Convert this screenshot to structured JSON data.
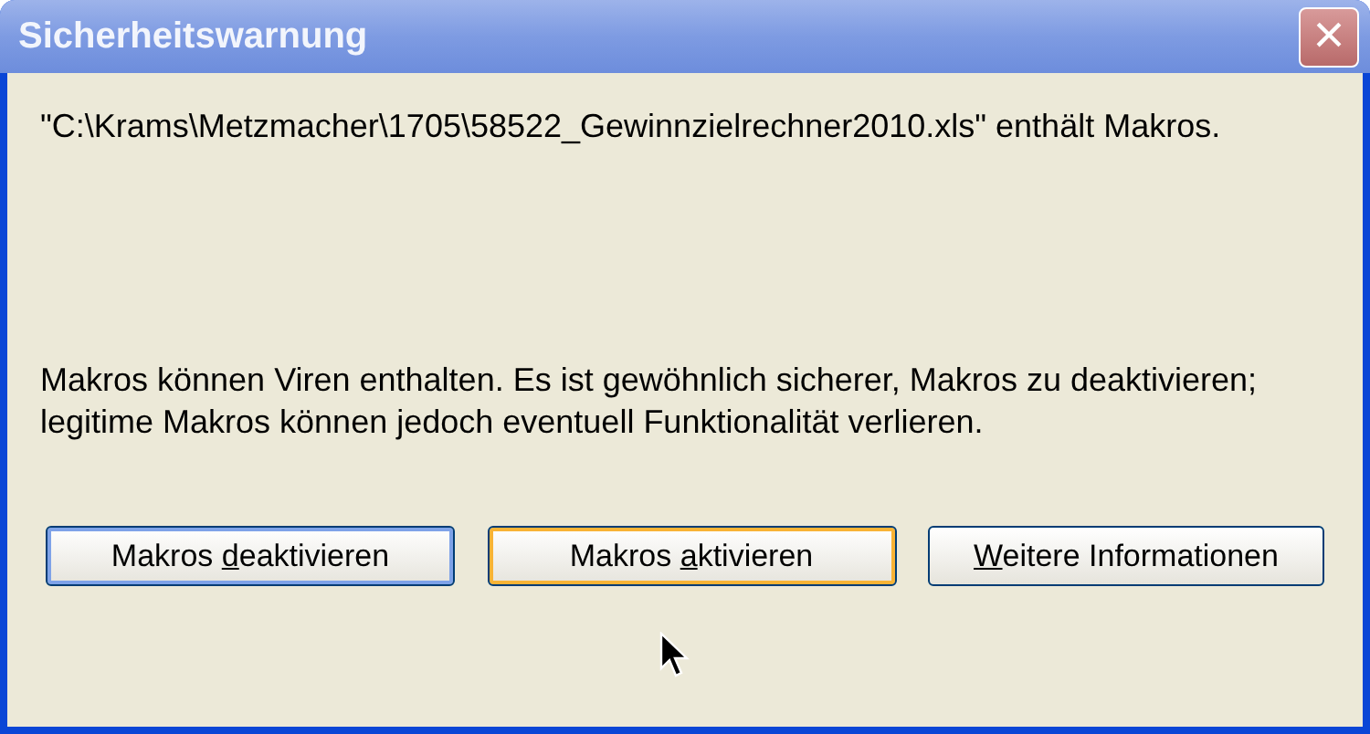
{
  "window": {
    "title": "Sicherheitswarnung",
    "close": "×"
  },
  "message": {
    "paragraphs": [
      "\"C:\\Krams\\Metzmacher\\1705\\58522_Gewinnzielrechner2010.xls\" enthält Makros.",
      "Makros können Viren enthalten. Es ist gewöhnlich sicherer, Makros zu deaktivieren; legitime Makros können jedoch eventuell Funktionalität verlieren."
    ]
  },
  "buttons": [
    {
      "before": "Makros ",
      "key": "d",
      "after": "eaktivieren",
      "focused": true,
      "hovered": false
    },
    {
      "before": "Makros ",
      "key": "a",
      "after": "ktivieren",
      "focused": false,
      "hovered": true
    },
    {
      "key": "W",
      "after": "eitere Informationen",
      "focused": false,
      "hovered": false
    }
  ]
}
